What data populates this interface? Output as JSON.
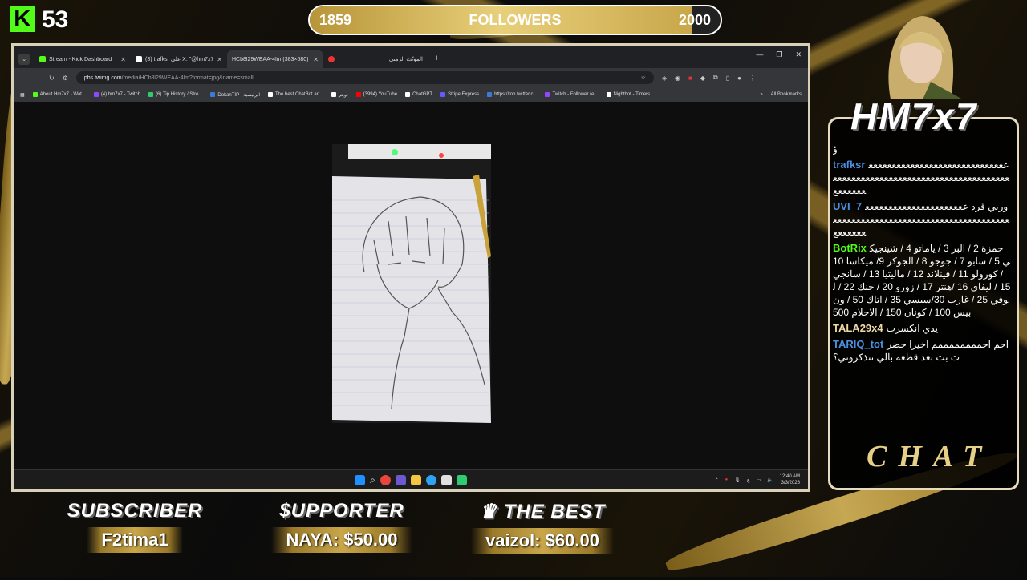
{
  "overlay": {
    "kick_count": "53",
    "followers": {
      "current": "1859",
      "label": "FOLLOWERS",
      "goal": "2000",
      "progress": 0.93
    },
    "channel_name": "HM7x7",
    "chat_title": "CHAT",
    "subscriber": {
      "heading": "SUBSCRIBER",
      "value": "F2tima1"
    },
    "supporter": {
      "heading": "$UPPORTER",
      "value": "NAYA: $50.00"
    },
    "best": {
      "heading": "THE BEST",
      "value": "vaizol: $60.00"
    }
  },
  "browser": {
    "tabs": [
      {
        "label": "Stream - Kick Dashboard",
        "icon": "kick-icon",
        "color": "#53fc18",
        "active": false
      },
      {
        "label": "(3) trafksr على X: \"@hm7x7_g",
        "icon": "x-icon",
        "color": "#ffffff",
        "active": false
      },
      {
        "label": "HCb8l29WEAA-4lm (383×680)",
        "icon": "image-icon",
        "color": "#888888",
        "active": true
      },
      {
        "label": "المونّت الزمني",
        "icon": "record-icon",
        "color": "#e33333",
        "active": false
      }
    ],
    "new_tab": "+",
    "url_host": "pbs.twimg.com",
    "url_path": "/media/HCb8l29WEAA-4lm?format=jpg&name=small",
    "bookmarks": [
      {
        "label": "About Hm7x7 - Wat...",
        "color": "#53fc18"
      },
      {
        "label": "(4) hm7x7 - Twitch",
        "color": "#9146ff"
      },
      {
        "label": "(6) Tip History / Stre...",
        "color": "#2ecc71"
      },
      {
        "label": "DokanTIP - الرئيسية",
        "color": "#3a7bd5"
      },
      {
        "label": "The best ChatBot an...",
        "color": "#ffffff"
      },
      {
        "label": "تويتر",
        "color": "#ffffff"
      },
      {
        "label": "(3994) YouTube",
        "color": "#ff0000"
      },
      {
        "label": "ChatGPT",
        "color": "#ffffff"
      },
      {
        "label": "Stripe Express",
        "color": "#635bff"
      },
      {
        "label": "https://ton.twitter.c...",
        "color": "#3a7bd5"
      },
      {
        "label": "Twitch - Follower re...",
        "color": "#9146ff"
      },
      {
        "label": "Nightbot - Timers",
        "color": "#ffffff"
      }
    ],
    "all_bookmarks": "All Bookmarks"
  },
  "taskbar": {
    "time": "12:40 AM",
    "date": "3/3/2026",
    "lang": "ع"
  },
  "chat": [
    {
      "user": "",
      "color": "#ffffff",
      "text": "ؤ"
    },
    {
      "user": "trafksr",
      "color": "#4a90e2",
      "text": "ععععععععععععععععععععععععععععععععععععععععععععععععععععععععععععععععععععععععععع"
    },
    {
      "user": "UVI_7",
      "color": "#4a90e2",
      "text": "وربي قرد ععععععععععععععععععععععععععععععععععععععععععععععععععععععععععععععععععع"
    },
    {
      "user": "BotRix",
      "color": "#53fc18",
      "text": "حمزة 2 / البر 3 / ياماتو 4 / شينجيكي 5 / سابو 7 / جوجو 8 / الجوكر 9/ ميكاسا 10 / كورولو 11 / فينلاند 12 / ماليتيا 13 / سانجي 15 / ليفاي 16 /هنتر 17 / زورو 20 / جنك 22 / لوفي 25 / غارب 30/سيسي 35 / اتاك 50 / ون بيس 100 / كونان 150 / الاحلام 500"
    },
    {
      "user": "TALA29x4",
      "color": "#f0d9a6",
      "text": "يدي انكسرت"
    },
    {
      "user": "TARIQ_tot",
      "color": "#4a90e2",
      "text": "احم احممممممممم اخيرا حضرت بث بعد قطعه بالي تتذكروني؟"
    }
  ]
}
